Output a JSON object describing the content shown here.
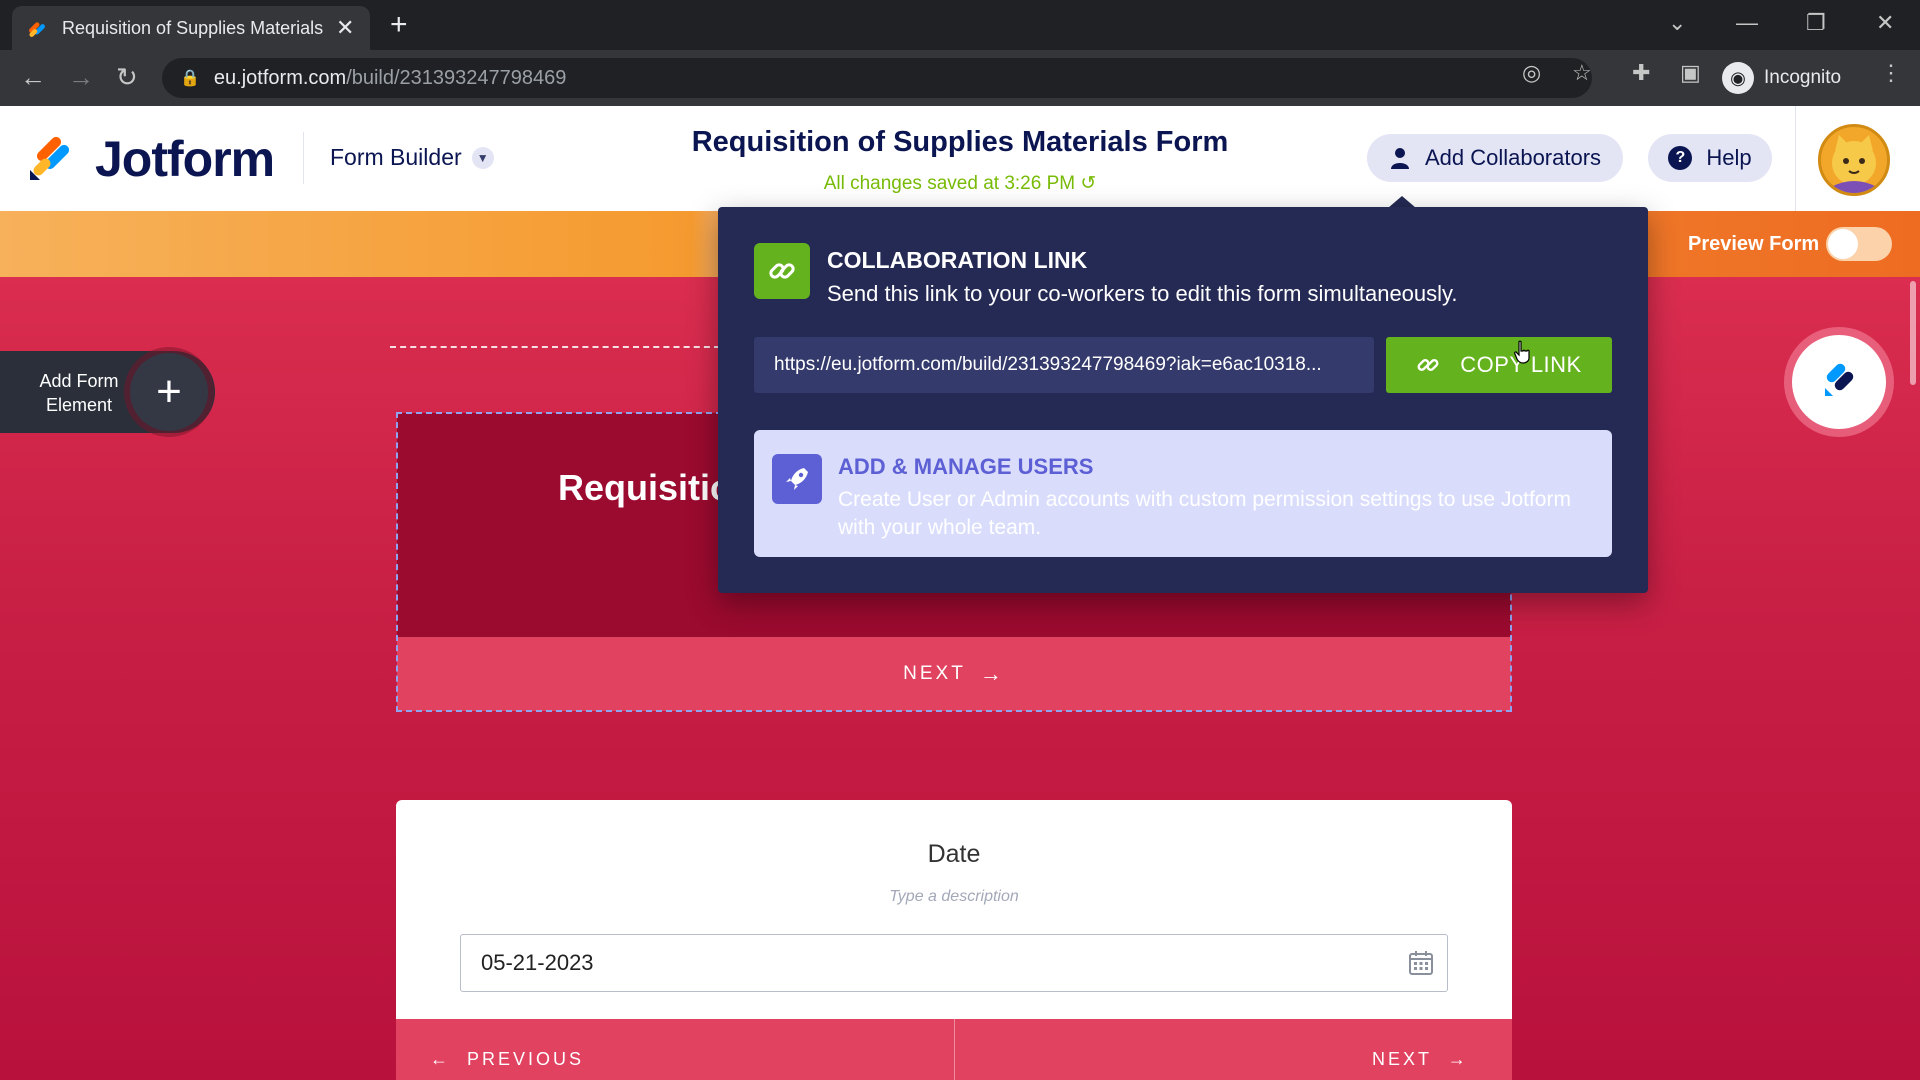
{
  "browser": {
    "tab_title": "Requisition of Supplies Materials Form",
    "url_host": "eu.jotform.com",
    "url_path": "/build/231393247798469",
    "profile_label": "Incognito"
  },
  "header": {
    "logo_text": "Jotform",
    "form_builder_label": "Form Builder",
    "form_title": "Requisition of Supplies Materials Form",
    "saved_status": "All changes saved at 3:26 PM",
    "add_collaborators_label": "Add Collaborators",
    "help_label": "Help"
  },
  "strip": {
    "preview_label": "Preview Form",
    "preview_enabled": false
  },
  "canvas": {
    "add_element_label": "Add Form Element",
    "card1_title": "Requisitio",
    "card1_next": "NEXT",
    "date_label": "Date",
    "date_description_placeholder": "Type a description",
    "date_value": "05-21-2023",
    "prev_label": "PREVIOUS",
    "next_label": "NEXT"
  },
  "popover": {
    "title": "COLLABORATION LINK",
    "subtitle": "Send this link to your co-workers to edit this form simultaneously.",
    "link": "https://eu.jotform.com/build/231393247798469?iak=e6ac10318...",
    "copy_label": "COPY LINK",
    "manage_title": "ADD & MANAGE USERS",
    "manage_desc": "Create User or Admin accounts with custom permission settings to use Jotform with your whole team."
  },
  "colors": {
    "brand_navy": "#0a1551",
    "accent_green": "#64b21d",
    "popover_bg": "#252a54",
    "canvas_red": "#c81f45"
  }
}
